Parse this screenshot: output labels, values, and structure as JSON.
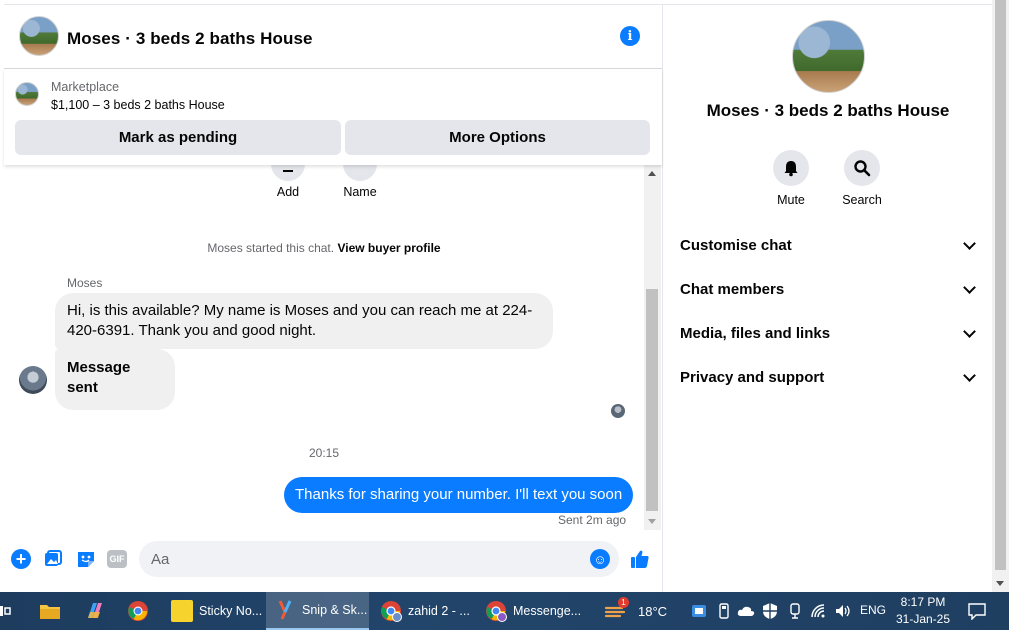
{
  "header": {
    "title": "Moses · 3 beds 2 baths House",
    "info_icon": "info-icon"
  },
  "marketplace": {
    "label": "Marketplace",
    "listing": "$1,100 – 3 beds 2 baths House",
    "mark_pending_label": "Mark as pending",
    "more_options_label": "More Options"
  },
  "quick_actions": [
    {
      "label": "Add",
      "icon": "add-icon"
    },
    {
      "label": "Name",
      "icon": "name-icon"
    }
  ],
  "conversation": {
    "system_text": "Moses started this chat.",
    "system_link": "View buyer profile",
    "sender_name": "Moses",
    "incoming": [
      "Hi, is this available? My name is Moses and you can reach me at 224-420-6391. Thank you and good night.",
      "Message sent"
    ],
    "timestamp": "20:15",
    "outgoing": "Thanks for sharing your number. I'll text you soon",
    "sent_status": "Sent 2m ago"
  },
  "composer": {
    "placeholder": "Aa",
    "value": "",
    "gif_label": "GIF",
    "icons": [
      "plus-icon",
      "photo-icon",
      "sticker-icon",
      "gif-icon",
      "emoji-icon",
      "like-icon"
    ]
  },
  "details": {
    "title": "Moses · 3 beds 2 baths House",
    "actions": [
      {
        "label": "Mute",
        "icon": "bell-icon"
      },
      {
        "label": "Search",
        "icon": "search-icon"
      }
    ],
    "sections": [
      "Customise chat",
      "Chat members",
      "Media, files and links",
      "Privacy and support"
    ]
  },
  "taskbar": {
    "tasks": [
      {
        "label": "Sticky No...",
        "icon": "sticky-notes-icon"
      },
      {
        "label": "Snip & Sk...",
        "icon": "snip-sketch-icon"
      },
      {
        "label": "zahid 2 - ...",
        "icon": "chrome-profile-icon"
      },
      {
        "label": "Messenge...",
        "icon": "chrome-messenger-icon"
      }
    ],
    "weather": "18°C",
    "weather_badge": "1",
    "language": "ENG",
    "time": "8:17 PM",
    "date": "31-Jan-25"
  },
  "colors": {
    "accent": "#0a7cff",
    "bubble_incoming": "#f0f0f0",
    "button_gray": "#e4e6eb",
    "secondary_text": "#65676b"
  }
}
